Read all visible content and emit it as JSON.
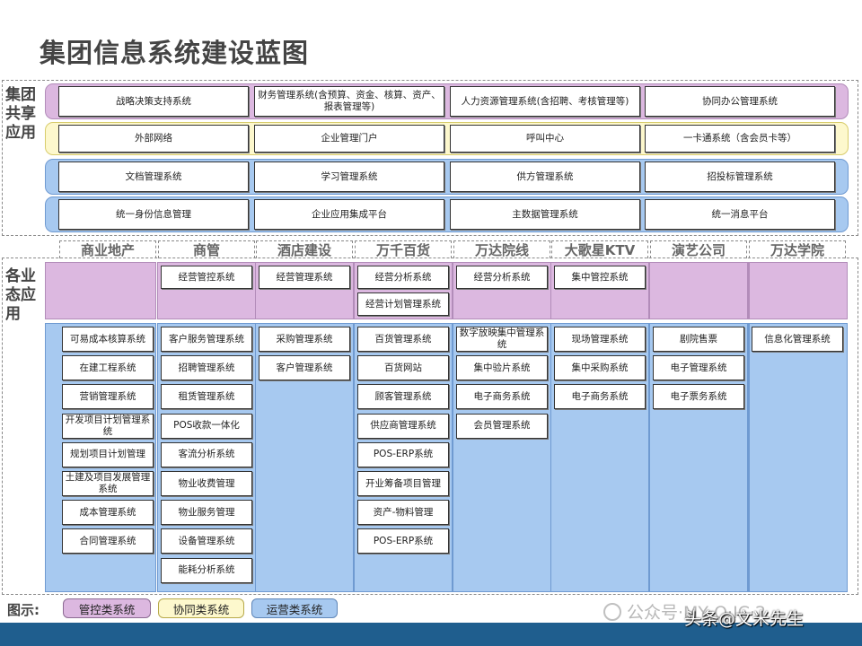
{
  "title": "集团信息系统建设蓝图",
  "shared": {
    "label": "集团共享应用",
    "rows": [
      {
        "color": "pink",
        "cells": [
          "战略决策支持系统",
          "财务管理系统(含预算、资金、核算、资产、报表管理等)",
          "人力资源管理系统(含招聘、考核管理等)",
          "协同办公管理系统"
        ]
      },
      {
        "color": "yellow",
        "cells": [
          "外部网络",
          "企业管理门户",
          "呼叫中心",
          "一卡通系统（含会员卡等）"
        ]
      },
      {
        "color": "blue",
        "cells": [
          "文档管理系统",
          "学习管理系统",
          "供方管理系统",
          "招投标管理系统"
        ]
      },
      {
        "color": "blue",
        "cells": [
          "统一身份信息管理",
          "企业应用集成平台",
          "主数据管理系统",
          "统一消息平台"
        ]
      }
    ]
  },
  "business": {
    "label": "各业态应用",
    "columns": [
      {
        "name": "商业地产",
        "control": [],
        "ops": [
          "可易成本核算系统",
          "在建工程系统",
          "营销管理系统",
          "开发项目计划管理系统",
          "规划项目计划管理",
          "土建及项目发展管理系统",
          "成本管理系统",
          "合同管理系统"
        ]
      },
      {
        "name": "商管",
        "control": [
          "经营管控系统"
        ],
        "ops": [
          "客户服务管理系统",
          "招聘管理系统",
          "租赁管理系统",
          "POS收款一体化",
          "客流分析系统",
          "物业收费管理",
          "物业服务管理",
          "设备管理系统",
          "能耗分析系统"
        ]
      },
      {
        "name": "酒店建设",
        "control": [
          "经营管理系统"
        ],
        "ops": [
          "采购管理系统",
          "客户管理系统"
        ]
      },
      {
        "name": "万千百货",
        "control": [
          "经营分析系统",
          "经营计划管理系统"
        ],
        "ops": [
          "百货管理系统",
          "百货网站",
          "顾客管理系统",
          "供应商管理系统",
          "POS-ERP系统",
          "开业筹备项目管理",
          "资产-物料管理",
          "POS-ERP系统"
        ]
      },
      {
        "name": "万达院线",
        "control": [
          "经营分析系统"
        ],
        "ops": [
          "数字放映集中管理系统",
          "集中验片系统",
          "电子商务系统",
          "会员管理系统"
        ]
      },
      {
        "name": "大歌星KTV",
        "control": [
          "集中管控系统"
        ],
        "ops": [
          "现场管理系统",
          "集中采购系统",
          "电子商务系统"
        ]
      },
      {
        "name": "演艺公司",
        "control": [],
        "ops": [
          "剧院售票",
          "电子管理系统",
          "电子票务系统"
        ]
      },
      {
        "name": "万达学院",
        "control": [],
        "ops": [
          "信息化管理系统"
        ]
      }
    ]
  },
  "legend": {
    "label": "图示:",
    "items": [
      {
        "label": "管控类系统",
        "color": "#dcb8e0"
      },
      {
        "label": "协同类系统",
        "color": "#fdf8cd"
      },
      {
        "label": "运营类系统",
        "color": "#a7c9f0"
      }
    ]
  },
  "watermark": "公众号·MY·O·IC·2",
  "author": "头条@文米先生"
}
